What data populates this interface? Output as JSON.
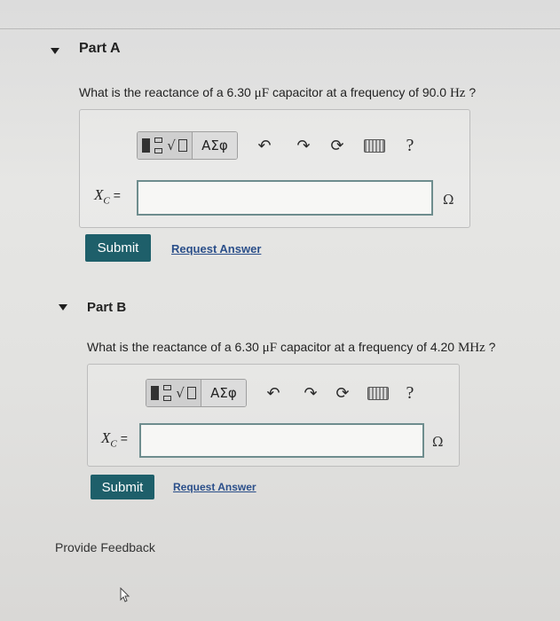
{
  "part_a": {
    "title": "Part A",
    "question_prefix": "What is the reactance of a 6.30 ",
    "question_unit1": "μF",
    "question_mid": " capacitor at a frequency of 90.0 ",
    "question_unit2": "Hz",
    "question_suffix": " ?",
    "toolbar": {
      "greek_label": "ΑΣφ",
      "help_label": "?"
    },
    "variable": "X",
    "variable_sub": "C",
    "equals": "=",
    "input_value": "",
    "unit": "Ω",
    "submit_label": "Submit",
    "request_label": "Request Answer"
  },
  "part_b": {
    "title": "Part B",
    "question_prefix": "What is the reactance of a 6.30 ",
    "question_unit1": "μF",
    "question_mid": " capacitor at a frequency of 4.20 ",
    "question_unit2": "MHz",
    "question_suffix": " ?",
    "toolbar": {
      "greek_label": "ΑΣφ",
      "help_label": "?"
    },
    "variable": "X",
    "variable_sub": "C",
    "equals": "=",
    "input_value": "",
    "unit": "Ω",
    "submit_label": "Submit",
    "request_label": "Request Answer"
  },
  "feedback_label": "Provide Feedback",
  "colors": {
    "submit_bg": "#1e5f6a",
    "link": "#2b4f8a",
    "input_border": "#6e8d8e"
  }
}
